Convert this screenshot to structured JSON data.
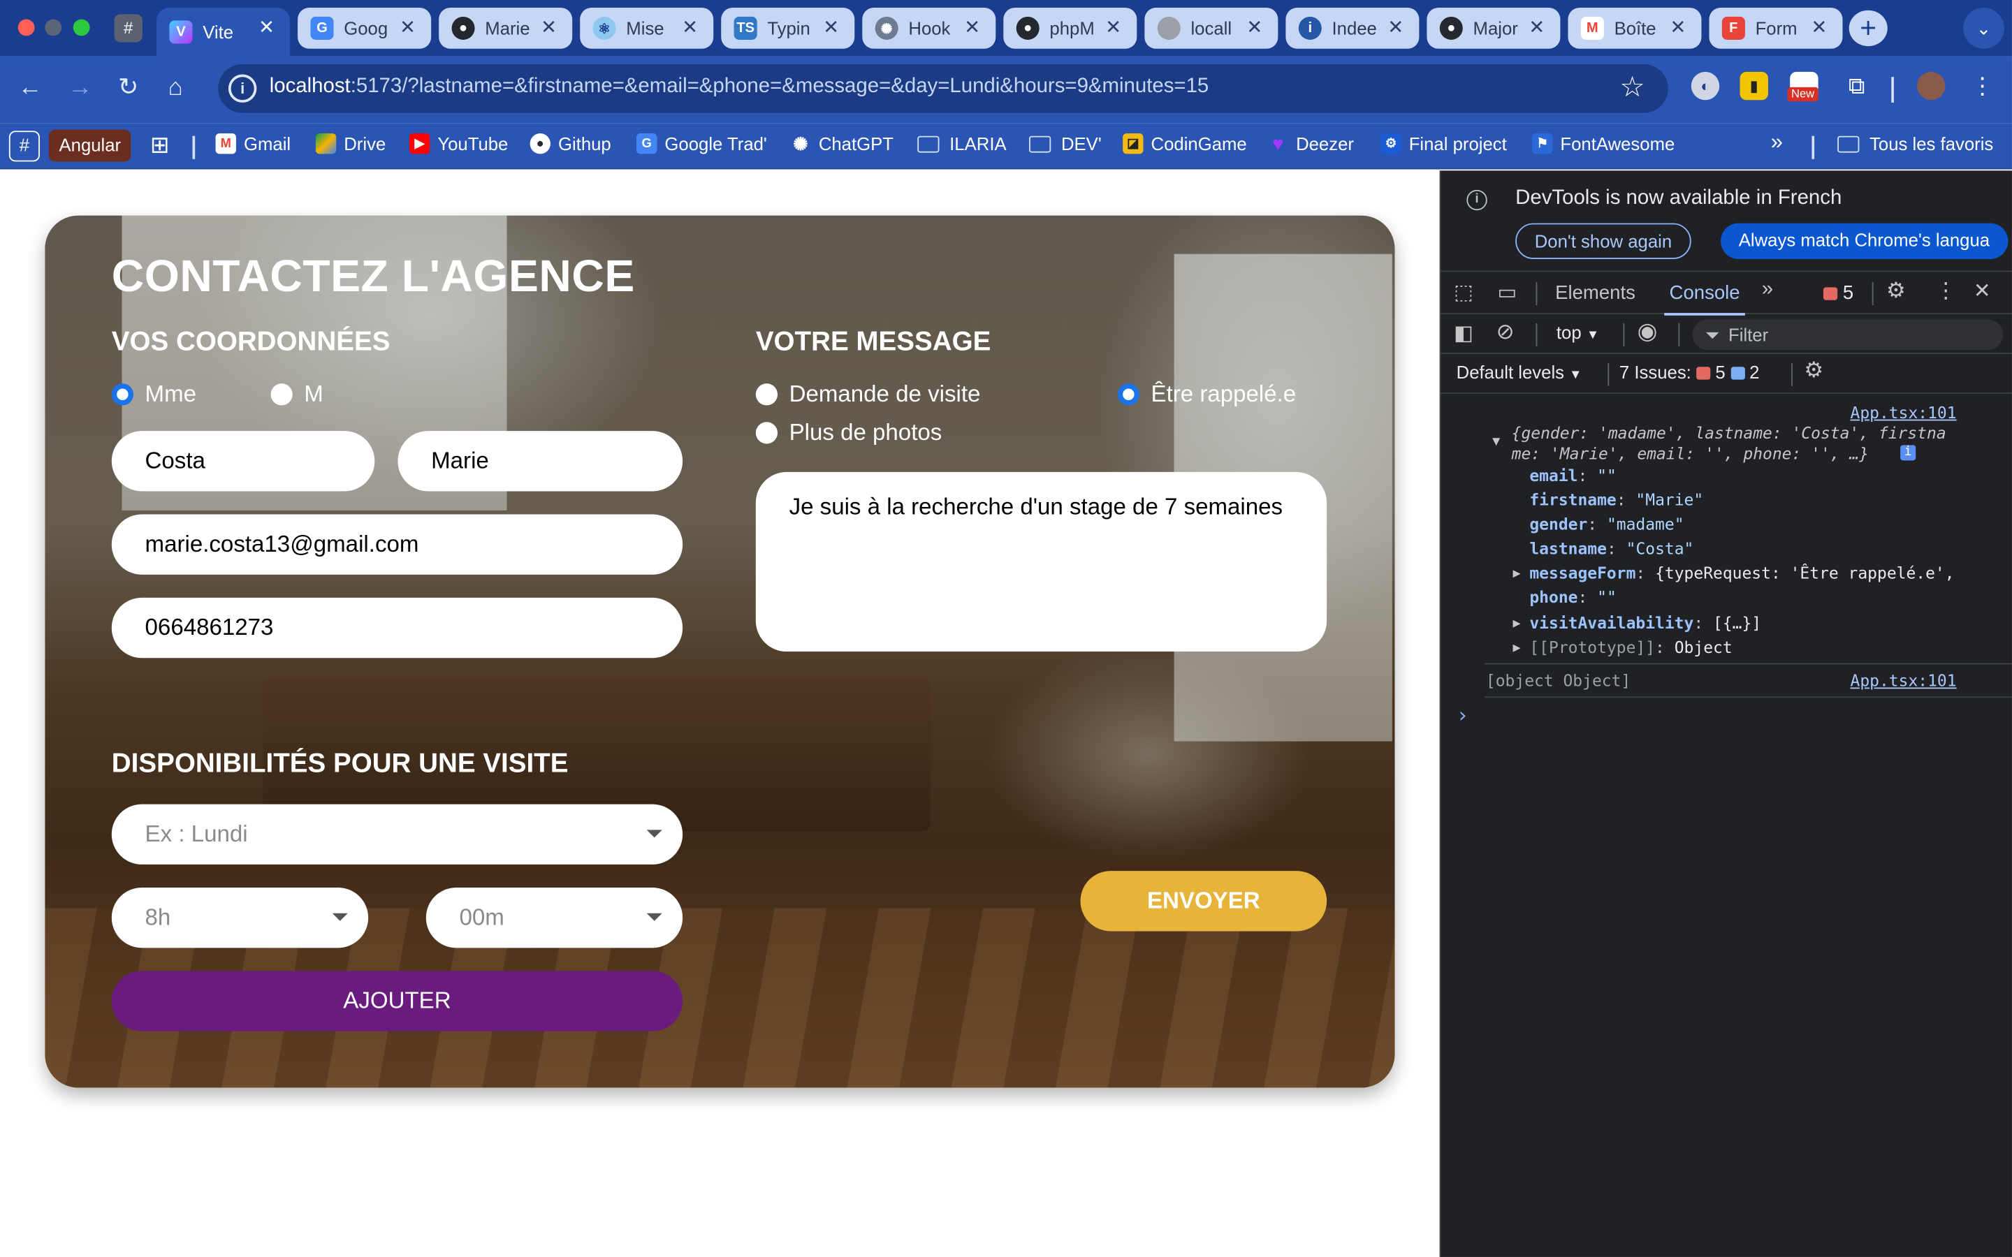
{
  "browser": {
    "tabs": [
      {
        "label": "Vite",
        "active": true
      },
      {
        "label": "Goog"
      },
      {
        "label": "Marie"
      },
      {
        "label": "Mise"
      },
      {
        "label": "Typin"
      },
      {
        "label": "Hook"
      },
      {
        "label": "phpM"
      },
      {
        "label": "locall"
      },
      {
        "label": "Indee"
      },
      {
        "label": "Major"
      },
      {
        "label": "Boîte"
      },
      {
        "label": "Form"
      }
    ],
    "pinned_tab_glyph": "#",
    "new_tab_glyph": "+",
    "url_host": "localhost",
    "url_path": ":5173/?lastname=&firstname=&email=&phone=&message=&day=Lundi&hours=9&minutes=15",
    "extension_badge": "New",
    "bookmarks": {
      "hash_glyph": "#",
      "angular": "Angular",
      "items": [
        "Gmail",
        "Drive",
        "YouTube",
        "Githup",
        "Google Trad'",
        "ChatGPT",
        "ILARIA",
        "DEV'",
        "CodinGame",
        "Deezer",
        "Final project",
        "FontAwesome"
      ],
      "more": "»",
      "all_bookmarks": "Tous les favoris"
    }
  },
  "form": {
    "title": "CONTACTEZ L'AGENCE",
    "coords_heading": "VOS COORDONNÉES",
    "gender_options": [
      "Mme",
      "M"
    ],
    "gender_selected": "Mme",
    "lastname_value": "Costa",
    "firstname_value": "Marie",
    "email_value": "marie.costa13@gmail.com",
    "phone_value": "0664861273",
    "message_heading": "VOTRE MESSAGE",
    "message_options": [
      "Demande de visite",
      "Être rappelé.e",
      "Plus de photos"
    ],
    "message_selected": "Être rappelé.e",
    "message_value": "Je suis à la recherche d'un stage de 7 semaines",
    "availability_heading": "DISPONIBILITÉS POUR UNE VISITE",
    "day_placeholder": "Ex : Lundi",
    "hours_value": "8h",
    "minutes_value": "00m",
    "add_button": "AJOUTER",
    "send_button": "ENVOYER",
    "colors": {
      "add_button": "#6a1b7e",
      "send_button": "#e8b33a",
      "radio_selected": "#1a73e8"
    }
  },
  "devtools": {
    "banner": "DevTools is now available in French",
    "dont_show": "Don't show again",
    "always_match": "Always match Chrome's langua",
    "tabs": [
      "Elements",
      "Console"
    ],
    "selected_tab": "Console",
    "error_count": "5",
    "context": "top",
    "filter_placeholder": "Filter",
    "default_levels": "Default levels",
    "issues_label": "7 Issues:",
    "issues_errors": "5",
    "issues_info": "2",
    "log": {
      "source": "App.tsx:101",
      "summary_line1": "{gender: 'madame', lastname: 'Costa', firstna",
      "summary_line2": "me: 'Marie', email: '', phone: '', …}",
      "props": [
        {
          "key": "email",
          "value": "\"\""
        },
        {
          "key": "firstname",
          "value": "\"Marie\""
        },
        {
          "key": "gender",
          "value": "\"madame\""
        },
        {
          "key": "lastname",
          "value": "\"Costa\""
        },
        {
          "key": "messageForm",
          "value": "{typeRequest: 'Être rappelé.e',"
        },
        {
          "key": "phone",
          "value": "\"\""
        },
        {
          "key": "visitAvailability",
          "value": "[{…}]"
        },
        {
          "key": "[[Prototype]]",
          "value": "Object"
        }
      ],
      "object_line": "[object Object]",
      "object_source": "App.tsx:101",
      "prompt": "›"
    }
  }
}
